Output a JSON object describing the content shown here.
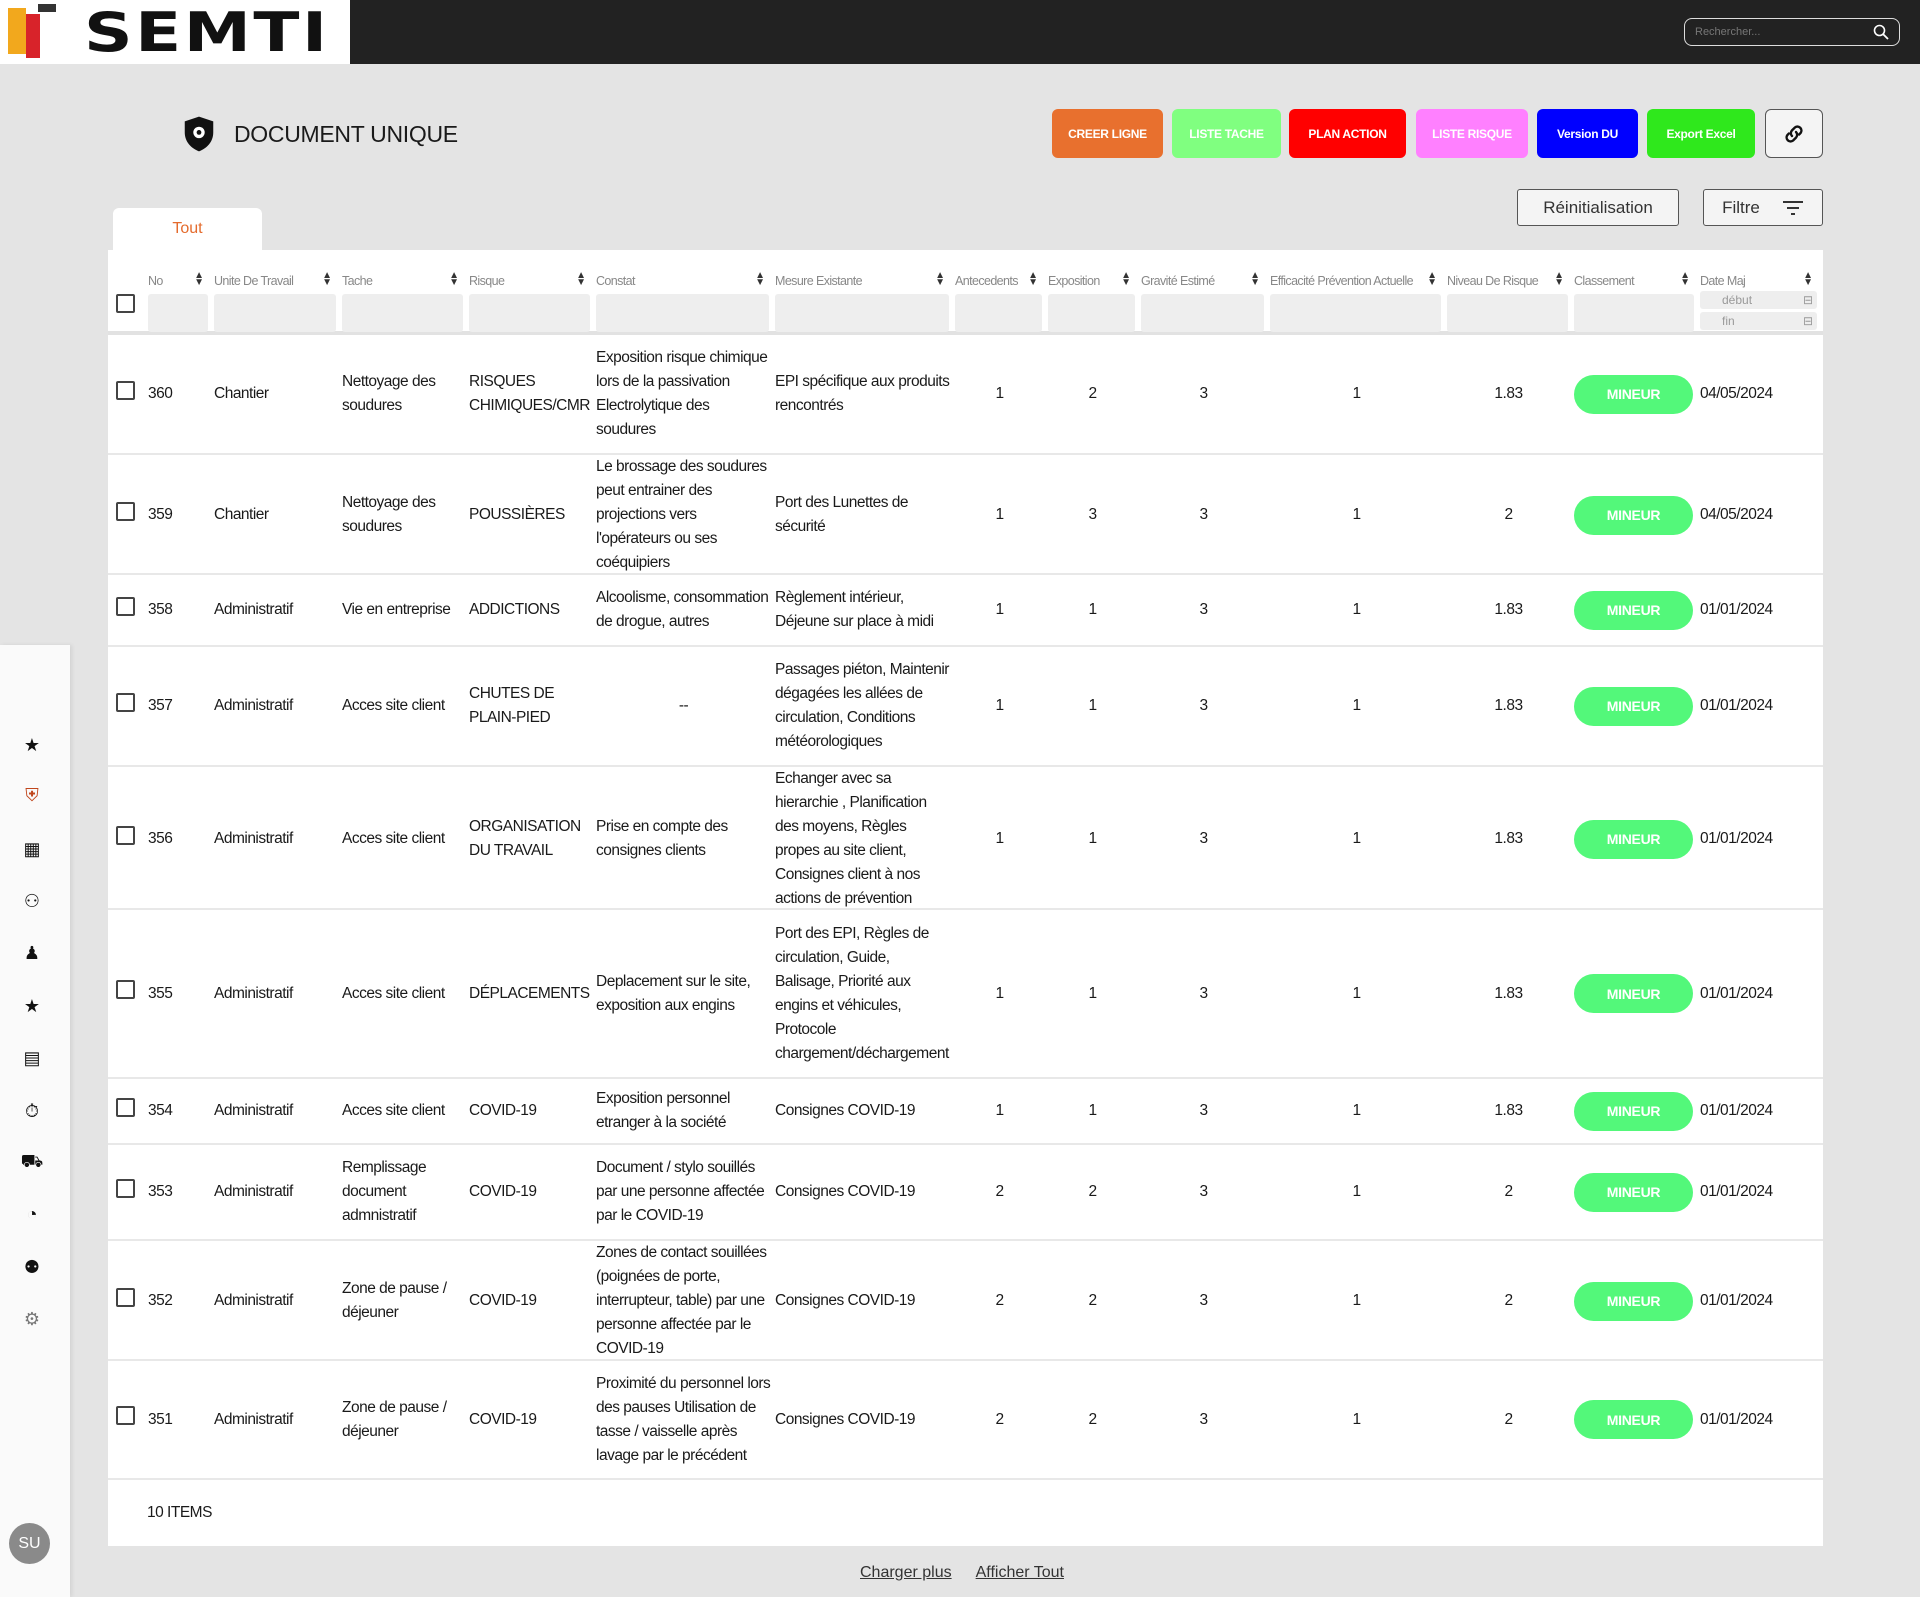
{
  "header": {
    "logo_text": "SEMTI",
    "search_placeholder": "Rechercher..."
  },
  "page": {
    "title": "DOCUMENT UNIQUE"
  },
  "toolbar": {
    "buttons": [
      {
        "label": "CREER LIGNE",
        "color": "#e8702e"
      },
      {
        "label": "LISTE TACHE",
        "color": "#80ff80"
      },
      {
        "label": "PLAN ACTION",
        "color": "#ff0000"
      },
      {
        "label": "LISTE RISQUE",
        "color": "#ff80ff"
      },
      {
        "label": "Version DU",
        "color": "#0000ff"
      },
      {
        "label": "Export Excel",
        "color": "#2fe81c"
      }
    ],
    "reset_label": "Réinitialisation",
    "filter_label": "Filtre"
  },
  "tabs": [
    {
      "label": "Tout",
      "active": true
    }
  ],
  "table": {
    "columns": [
      "No",
      "Unite De Travail",
      "Tache",
      "Risque",
      "Constat",
      "Mesure Existante",
      "Antecedents",
      "Exposition",
      "Gravité Estimé",
      "Efficacité Prévention Actuelle",
      "Niveau De Risque",
      "Classement",
      "Date Maj"
    ],
    "date_filter": {
      "start": "début",
      "end": "fin"
    },
    "rows": [
      {
        "no": "360",
        "unite": "Chantier",
        "tache": "Nettoyage des soudures",
        "risque": "RISQUES CHIMIQUES/CMR",
        "constat": "Exposition risque chimique lors de la passivation Electrolytique des soudures",
        "mesure": "EPI spécifique aux produits rencontrés",
        "antecedents": "1",
        "exposition": "2",
        "gravite": "3",
        "efficacite": "1",
        "niveau": "1.83",
        "classement": "MINEUR",
        "date": "04/05/2024"
      },
      {
        "no": "359",
        "unite": "Chantier",
        "tache": "Nettoyage des soudures",
        "risque": "POUSSIÈRES",
        "constat": "Le brossage des soudures peut entrainer des projections vers l'opérateurs ou ses coéquipiers",
        "mesure": "Port des Lunettes de sécurité",
        "antecedents": "1",
        "exposition": "3",
        "gravite": "3",
        "efficacite": "1",
        "niveau": "2",
        "classement": "MINEUR",
        "date": "04/05/2024"
      },
      {
        "no": "358",
        "unite": "Administratif",
        "tache": "Vie en entreprise",
        "risque": "ADDICTIONS",
        "constat": "Alcoolisme, consommation de drogue, autres",
        "mesure": "Règlement intérieur, Déjeune sur place à midi",
        "antecedents": "1",
        "exposition": "1",
        "gravite": "3",
        "efficacite": "1",
        "niveau": "1.83",
        "classement": "MINEUR",
        "date": "01/01/2024"
      },
      {
        "no": "357",
        "unite": "Administratif",
        "tache": "Acces site client",
        "risque": "CHUTES DE PLAIN-PIED",
        "constat": "--",
        "mesure": "Passages piéton, Maintenir dégagées les allées de circulation, Conditions météorologiques",
        "antecedents": "1",
        "exposition": "1",
        "gravite": "3",
        "efficacite": "1",
        "niveau": "1.83",
        "classement": "MINEUR",
        "date": "01/01/2024"
      },
      {
        "no": "356",
        "unite": "Administratif",
        "tache": "Acces site client",
        "risque": "ORGANISATION DU TRAVAIL",
        "constat": "Prise en compte des consignes clients",
        "mesure": "Echanger avec sa hierarchie , Planification des moyens, Règles propes au site client, Consignes client à nos actions de prévention",
        "antecedents": "1",
        "exposition": "1",
        "gravite": "3",
        "efficacite": "1",
        "niveau": "1.83",
        "classement": "MINEUR",
        "date": "01/01/2024"
      },
      {
        "no": "355",
        "unite": "Administratif",
        "tache": "Acces site client",
        "risque": "DÉPLACEMENTS",
        "constat": "Deplacement sur le site, exposition aux engins",
        "mesure": "Port des EPI, Règles de circulation, Guide, Balisage, Priorité aux engins et véhicules, Protocole chargement/déchargement",
        "antecedents": "1",
        "exposition": "1",
        "gravite": "3",
        "efficacite": "1",
        "niveau": "1.83",
        "classement": "MINEUR",
        "date": "01/01/2024"
      },
      {
        "no": "354",
        "unite": "Administratif",
        "tache": "Acces site client",
        "risque": "COVID-19",
        "constat": "Exposition personnel etranger à la société",
        "mesure": "Consignes COVID-19",
        "antecedents": "1",
        "exposition": "1",
        "gravite": "3",
        "efficacite": "1",
        "niveau": "1.83",
        "classement": "MINEUR",
        "date": "01/01/2024"
      },
      {
        "no": "353",
        "unite": "Administratif",
        "tache": "Remplissage document admnistratif",
        "risque": "COVID-19",
        "constat": "Document / stylo souillés par une personne affectée par le COVID-19",
        "mesure": "Consignes COVID-19",
        "antecedents": "2",
        "exposition": "2",
        "gravite": "3",
        "efficacite": "1",
        "niveau": "2",
        "classement": "MINEUR",
        "date": "01/01/2024"
      },
      {
        "no": "352",
        "unite": "Administratif",
        "tache": "Zone de pause / déjeuner",
        "risque": "COVID-19",
        "constat": "Zones de contact souillées (poignées de porte, interrupteur, table) par une personne affectée par le COVID-19",
        "mesure": "Consignes COVID-19",
        "antecedents": "2",
        "exposition": "2",
        "gravite": "3",
        "efficacite": "1",
        "niveau": "2",
        "classement": "MINEUR",
        "date": "01/01/2024"
      },
      {
        "no": "351",
        "unite": "Administratif",
        "tache": "Zone de pause / déjeuner",
        "risque": "COVID-19",
        "constat": "Proximité du personnel lors des pauses Utilisation de tasse / vaisselle après lavage par le précédent",
        "mesure": "Consignes COVID-19",
        "antecedents": "2",
        "exposition": "2",
        "gravite": "3",
        "efficacite": "1",
        "niveau": "2",
        "classement": "MINEUR",
        "date": "01/01/2024"
      }
    ],
    "items_count": "10 ITEMS"
  },
  "pagination": {
    "load_more": "Charger plus",
    "show_all": "Afficher Tout"
  },
  "sidebar": {
    "icons": [
      "star-badge-icon",
      "shield-gear-icon",
      "calendar-icon",
      "user-star-icon",
      "user-tie-icon",
      "star-badge-icon",
      "invoice-icon",
      "stopwatch-icon",
      "excavator-icon",
      "pie-chart-icon",
      "team-icon",
      "gears-icon"
    ],
    "avatar_initials": "SU"
  },
  "colors": {
    "accent": "#e46b2d",
    "badge_minor": "#53f87a",
    "topbar": "#222222"
  }
}
